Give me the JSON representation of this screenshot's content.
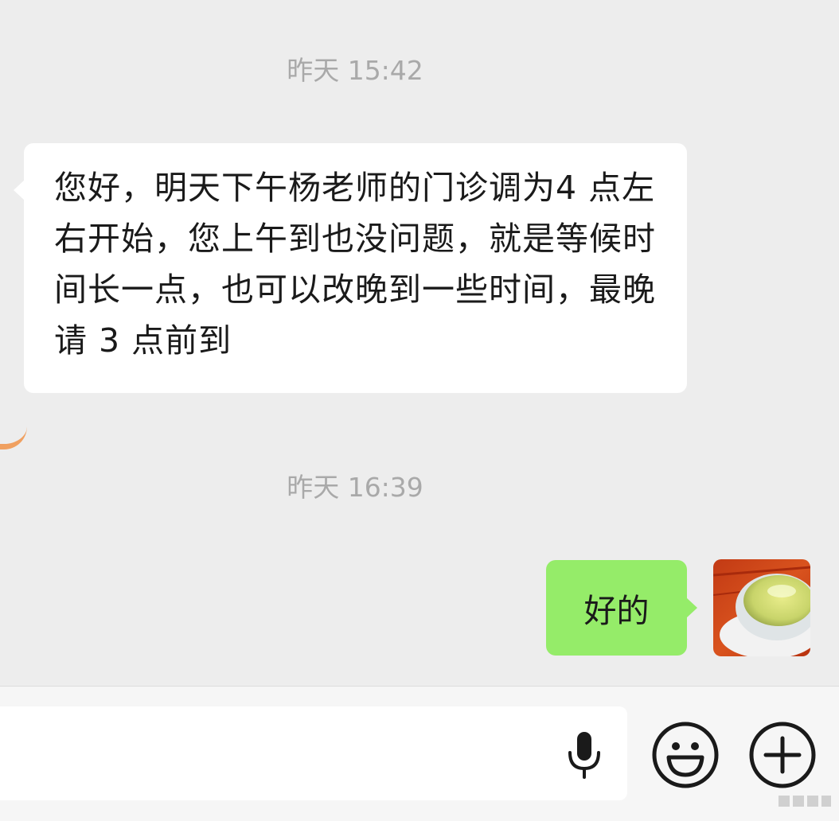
{
  "chat": {
    "messages": [
      {
        "timestamp": "昨天 15:42",
        "sender": "other",
        "text": "您好，明天下午杨老师的门诊调为4 点左右开始，您上午到也没问题，就是等候时间长一点，也可以改晚到一些时间，最晚请 3 点前到"
      },
      {
        "timestamp": "昨天 16:39",
        "sender": "me",
        "text": "好的"
      }
    ]
  },
  "input_bar": {
    "icons": [
      "mic-icon",
      "emoji-icon",
      "plus-icon"
    ]
  },
  "colors": {
    "background": "#ededed",
    "incoming_bubble": "#ffffff",
    "outgoing_bubble": "#95ec69",
    "timestamp_text": "#a9a9a9"
  }
}
